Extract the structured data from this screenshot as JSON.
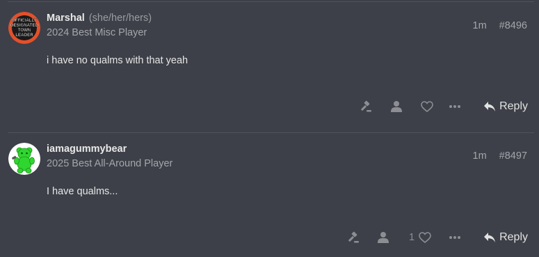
{
  "posts": [
    {
      "username": "Marshal",
      "pronouns": "(she/her/hers)",
      "title": "2024 Best Misc Player",
      "time": "1m",
      "post_number": "#8496",
      "body": "i have no qualms with that yeah",
      "avatar_text": [
        "OFFICIALLY",
        "DESIGNATED",
        "TOWN",
        "LEADER"
      ],
      "like_count": "",
      "actions": {
        "reply_label": "Reply"
      }
    },
    {
      "username": "iamagummybear",
      "pronouns": "",
      "title": "2025 Best All-Around Player",
      "time": "1m",
      "post_number": "#8497",
      "body": "I have qualms...",
      "like_count": "1",
      "actions": {
        "reply_label": "Reply"
      }
    }
  ],
  "icons": {
    "admin": "gavel-icon",
    "user": "user-icon",
    "like": "heart-icon",
    "more": "ellipsis-icon",
    "reply": "reply-arrow-icon"
  },
  "colors": {
    "background": "#3d4048",
    "avatar1_bg": "#e4502a",
    "avatar2_bg": "#ffffff",
    "gummy": "#2fd62f"
  }
}
